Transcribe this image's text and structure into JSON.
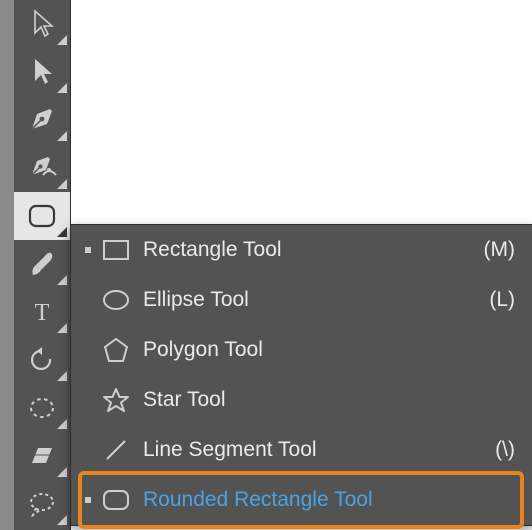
{
  "toolbar": {
    "tools": [
      {
        "name": "selection-tool"
      },
      {
        "name": "direct-selection-tool"
      },
      {
        "name": "pen-tool"
      },
      {
        "name": "curvature-tool"
      },
      {
        "name": "rectangle-tool",
        "selected": true
      },
      {
        "name": "paintbrush-tool"
      },
      {
        "name": "type-tool"
      },
      {
        "name": "rotate-tool"
      },
      {
        "name": "ellipse-marquee-tool"
      },
      {
        "name": "eraser-tool"
      },
      {
        "name": "lasso-tool"
      }
    ]
  },
  "flyout": {
    "items": [
      {
        "id": "rectangle",
        "label": "Rectangle Tool",
        "shortcut": "(M)",
        "indicator": true
      },
      {
        "id": "ellipse",
        "label": "Ellipse Tool",
        "shortcut": "(L)",
        "indicator": false
      },
      {
        "id": "polygon",
        "label": "Polygon Tool",
        "shortcut": "",
        "indicator": false
      },
      {
        "id": "star",
        "label": "Star Tool",
        "shortcut": "",
        "indicator": false
      },
      {
        "id": "line",
        "label": "Line Segment Tool",
        "shortcut": "(\\)",
        "indicator": false
      },
      {
        "id": "rounded-rectangle",
        "label": "Rounded Rectangle Tool",
        "shortcut": "",
        "indicator": true,
        "highlight": true
      }
    ]
  },
  "colors": {
    "highlight_border": "#e8841c",
    "highlight_text": "#4aa3e0"
  }
}
